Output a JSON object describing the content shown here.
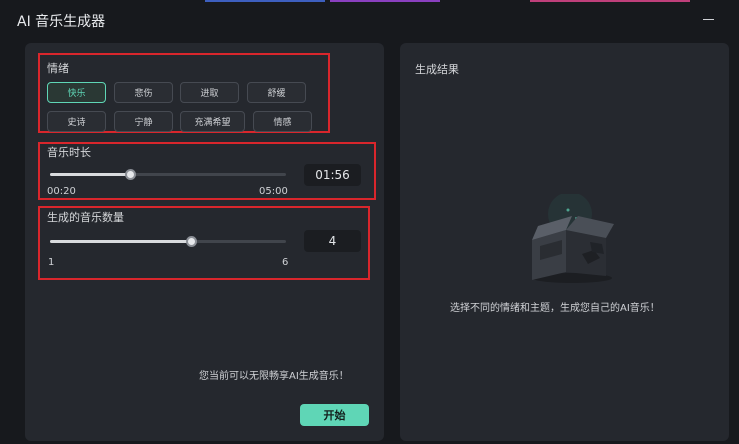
{
  "window": {
    "title": "AI 音乐生成器",
    "minimize_label": "—"
  },
  "mood": {
    "label": "情绪",
    "options": [
      "快乐",
      "悲伤",
      "进取",
      "舒缓",
      "史诗",
      "宁静",
      "充满希望",
      "情感"
    ],
    "selected": "快乐"
  },
  "duration": {
    "label": "音乐时长",
    "min_label": "00:20",
    "max_label": "05:00",
    "value": "01:56",
    "fraction": 0.34
  },
  "count": {
    "label": "生成的音乐数量",
    "min_label": "1",
    "max_label": "6",
    "value": "4",
    "fraction": 0.6
  },
  "footer": {
    "promo_text": "您当前可以无限畅享AI生成音乐！",
    "start_label": "开始"
  },
  "result": {
    "label": "生成结果",
    "empty_message": "选择不同的情绪和主题，生成您自己的AI音乐！"
  },
  "colors": {
    "accent": "#5fd6b6",
    "highlight_box": "#d9262c",
    "panel": "#25282e",
    "background": "#17191d"
  }
}
